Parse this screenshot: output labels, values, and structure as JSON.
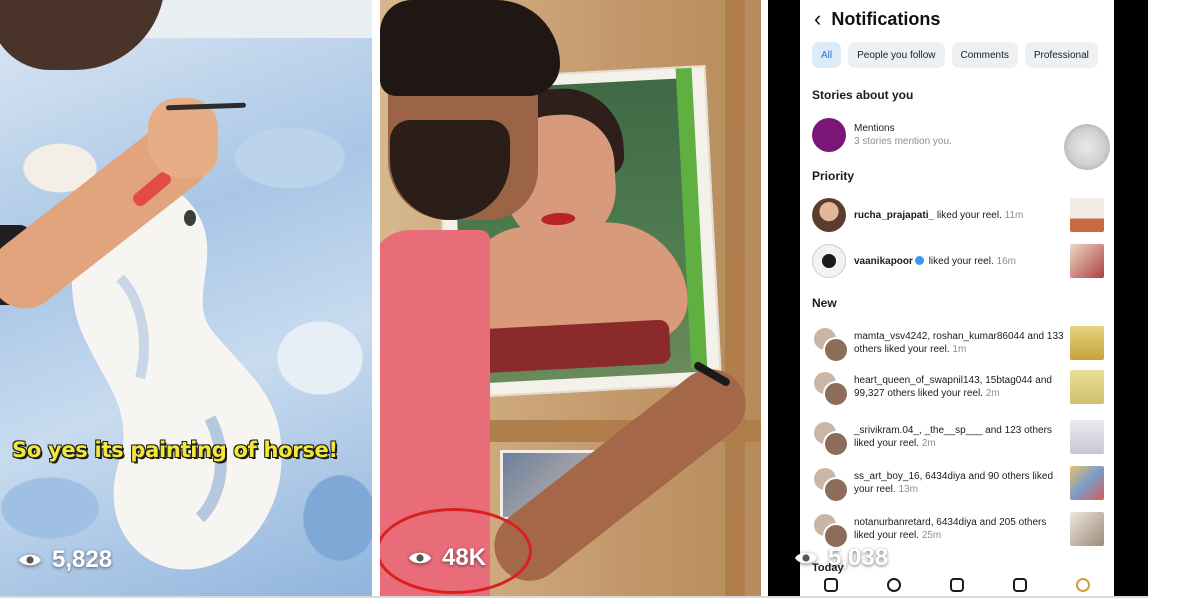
{
  "panels": {
    "horse": {
      "caption": "So yes its painting of horse!",
      "views": "5,828"
    },
    "portrait": {
      "views": "48K",
      "highlight_color": "#d91f1f"
    },
    "notifications": {
      "back_icon": "chevron-left-icon",
      "title": "Notifications",
      "filters": [
        "All",
        "People you follow",
        "Comments",
        "Professional"
      ],
      "sections": {
        "stories": "Stories about you",
        "priority": "Priority",
        "new": "New",
        "today": "Today"
      },
      "mentions": {
        "title": "Mentions",
        "subtitle": "3 stories mention you."
      },
      "priority_items": [
        {
          "user": "rucha_prajapati_",
          "text": " liked your reel. ",
          "time": "11m"
        },
        {
          "user": "vaanikapoor",
          "text": " liked your reel. ",
          "time": "16m"
        }
      ],
      "new_items": [
        {
          "text": "mamta_vsv4242, roshan_kumar86044 and 133 others liked your reel. ",
          "time": "1m"
        },
        {
          "text": "heart_queen_of_swapnil143, 15btag044 and 99,327 others liked your reel. ",
          "time": "2m"
        },
        {
          "text": "_srivikram.04_, _the__sp___ and 123 others liked your reel. ",
          "time": "2m"
        },
        {
          "text": "ss_art_boy_16, 6434diya and 90 others liked your reel. ",
          "time": "13m"
        },
        {
          "text": "notanurbanretard, 6434diya and 205 others liked your reel. ",
          "time": "25m"
        }
      ],
      "views": "5,038"
    }
  }
}
